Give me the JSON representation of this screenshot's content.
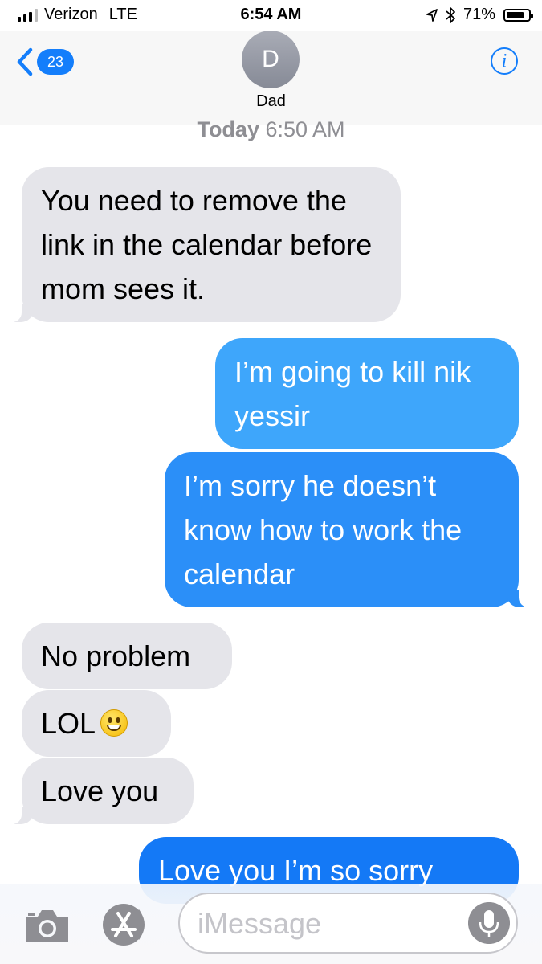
{
  "status_bar": {
    "carrier": "Verizon",
    "network": "LTE",
    "time": "6:54 AM",
    "battery": "71%",
    "battery_level": 0.71,
    "icons": [
      "signal-bars-icon",
      "location-arrow-icon",
      "bluetooth-icon",
      "battery-icon"
    ]
  },
  "header": {
    "back_count": "23",
    "avatar_initial": "D",
    "contact_name": "Dad",
    "info_label": "i"
  },
  "conversation": {
    "timestamp_day": "Today",
    "timestamp_time": "6:50 AM",
    "messages": [
      {
        "direction": "incoming",
        "text": "You need to remove the link in the calendar before mom sees it."
      },
      {
        "direction": "outgoing",
        "text": "I’m going to kill nik yessir"
      },
      {
        "direction": "outgoing",
        "text": "I’m sorry he doesn’t know how to work the calendar"
      },
      {
        "direction": "incoming",
        "text": "No problem"
      },
      {
        "direction": "incoming",
        "text": "LOL",
        "emoji": "grinning-face-emoji"
      },
      {
        "direction": "incoming",
        "text": "Love you"
      },
      {
        "direction": "outgoing",
        "text": "Love you I’m so sorry"
      }
    ]
  },
  "composer": {
    "placeholder": "iMessage",
    "value": ""
  },
  "colors": {
    "ios_blue": "#147efb",
    "incoming_bubble": "#e5e5ea"
  }
}
